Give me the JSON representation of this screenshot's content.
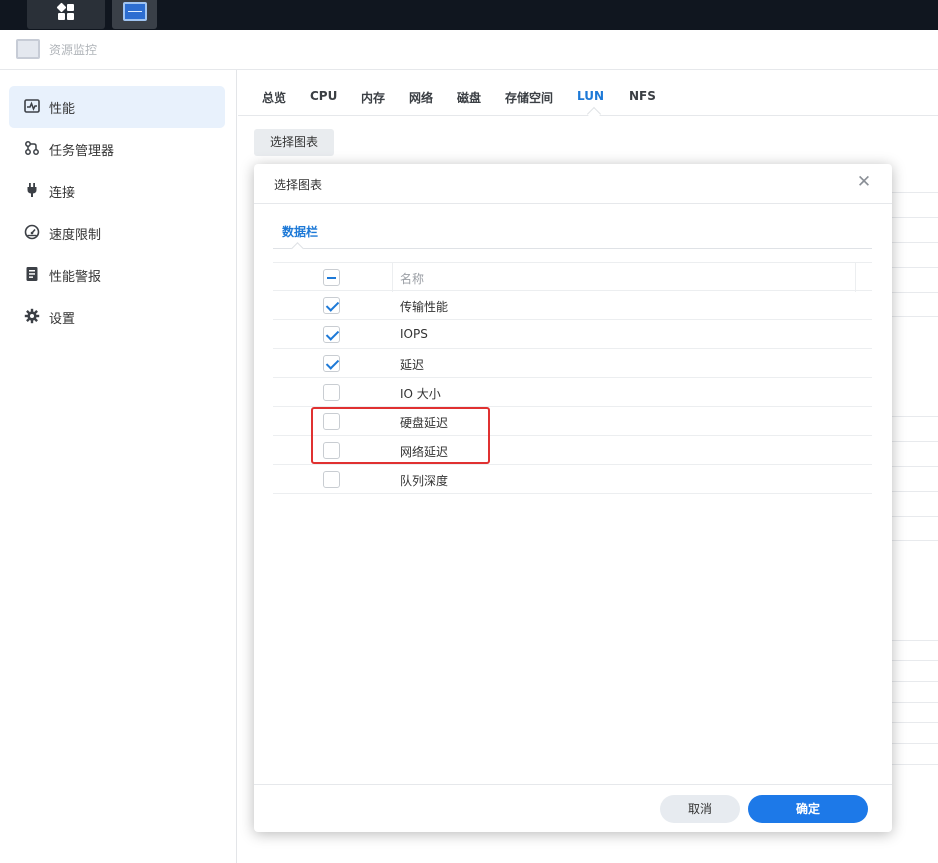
{
  "window": {
    "title": "资源监控"
  },
  "sidebar": {
    "items": [
      {
        "label": "性能",
        "icon": "performance-icon",
        "active": true
      },
      {
        "label": "任务管理器",
        "icon": "task-manager-icon",
        "active": false
      },
      {
        "label": "连接",
        "icon": "plug-icon",
        "active": false
      },
      {
        "label": "速度限制",
        "icon": "speedometer-icon",
        "active": false
      },
      {
        "label": "性能警报",
        "icon": "alert-list-icon",
        "active": false
      },
      {
        "label": "设置",
        "icon": "gear-icon",
        "active": false
      }
    ]
  },
  "tabs": {
    "items": [
      "总览",
      "CPU",
      "内存",
      "网络",
      "磁盘",
      "存储空间",
      "LUN",
      "NFS"
    ],
    "active": "LUN"
  },
  "toolbar": {
    "select_chart_label": "选择图表"
  },
  "dialog": {
    "title": "选择图表",
    "tab": "数据栏",
    "header": {
      "label": "名称",
      "state": "partial"
    },
    "rows": [
      {
        "label": "传输性能",
        "checked": true
      },
      {
        "label": "IOPS",
        "checked": true
      },
      {
        "label": "延迟",
        "checked": true
      },
      {
        "label": "IO 大小",
        "checked": false
      },
      {
        "label": "硬盘延迟",
        "checked": false
      },
      {
        "label": "网络延迟",
        "checked": false
      },
      {
        "label": "队列深度",
        "checked": false
      }
    ],
    "cancel_label": "取消",
    "ok_label": "确定"
  },
  "colors": {
    "accent": "#1d79d7",
    "primary_button": "#1d79e8",
    "highlight": "#e03131",
    "taskbar": "#10161f"
  }
}
